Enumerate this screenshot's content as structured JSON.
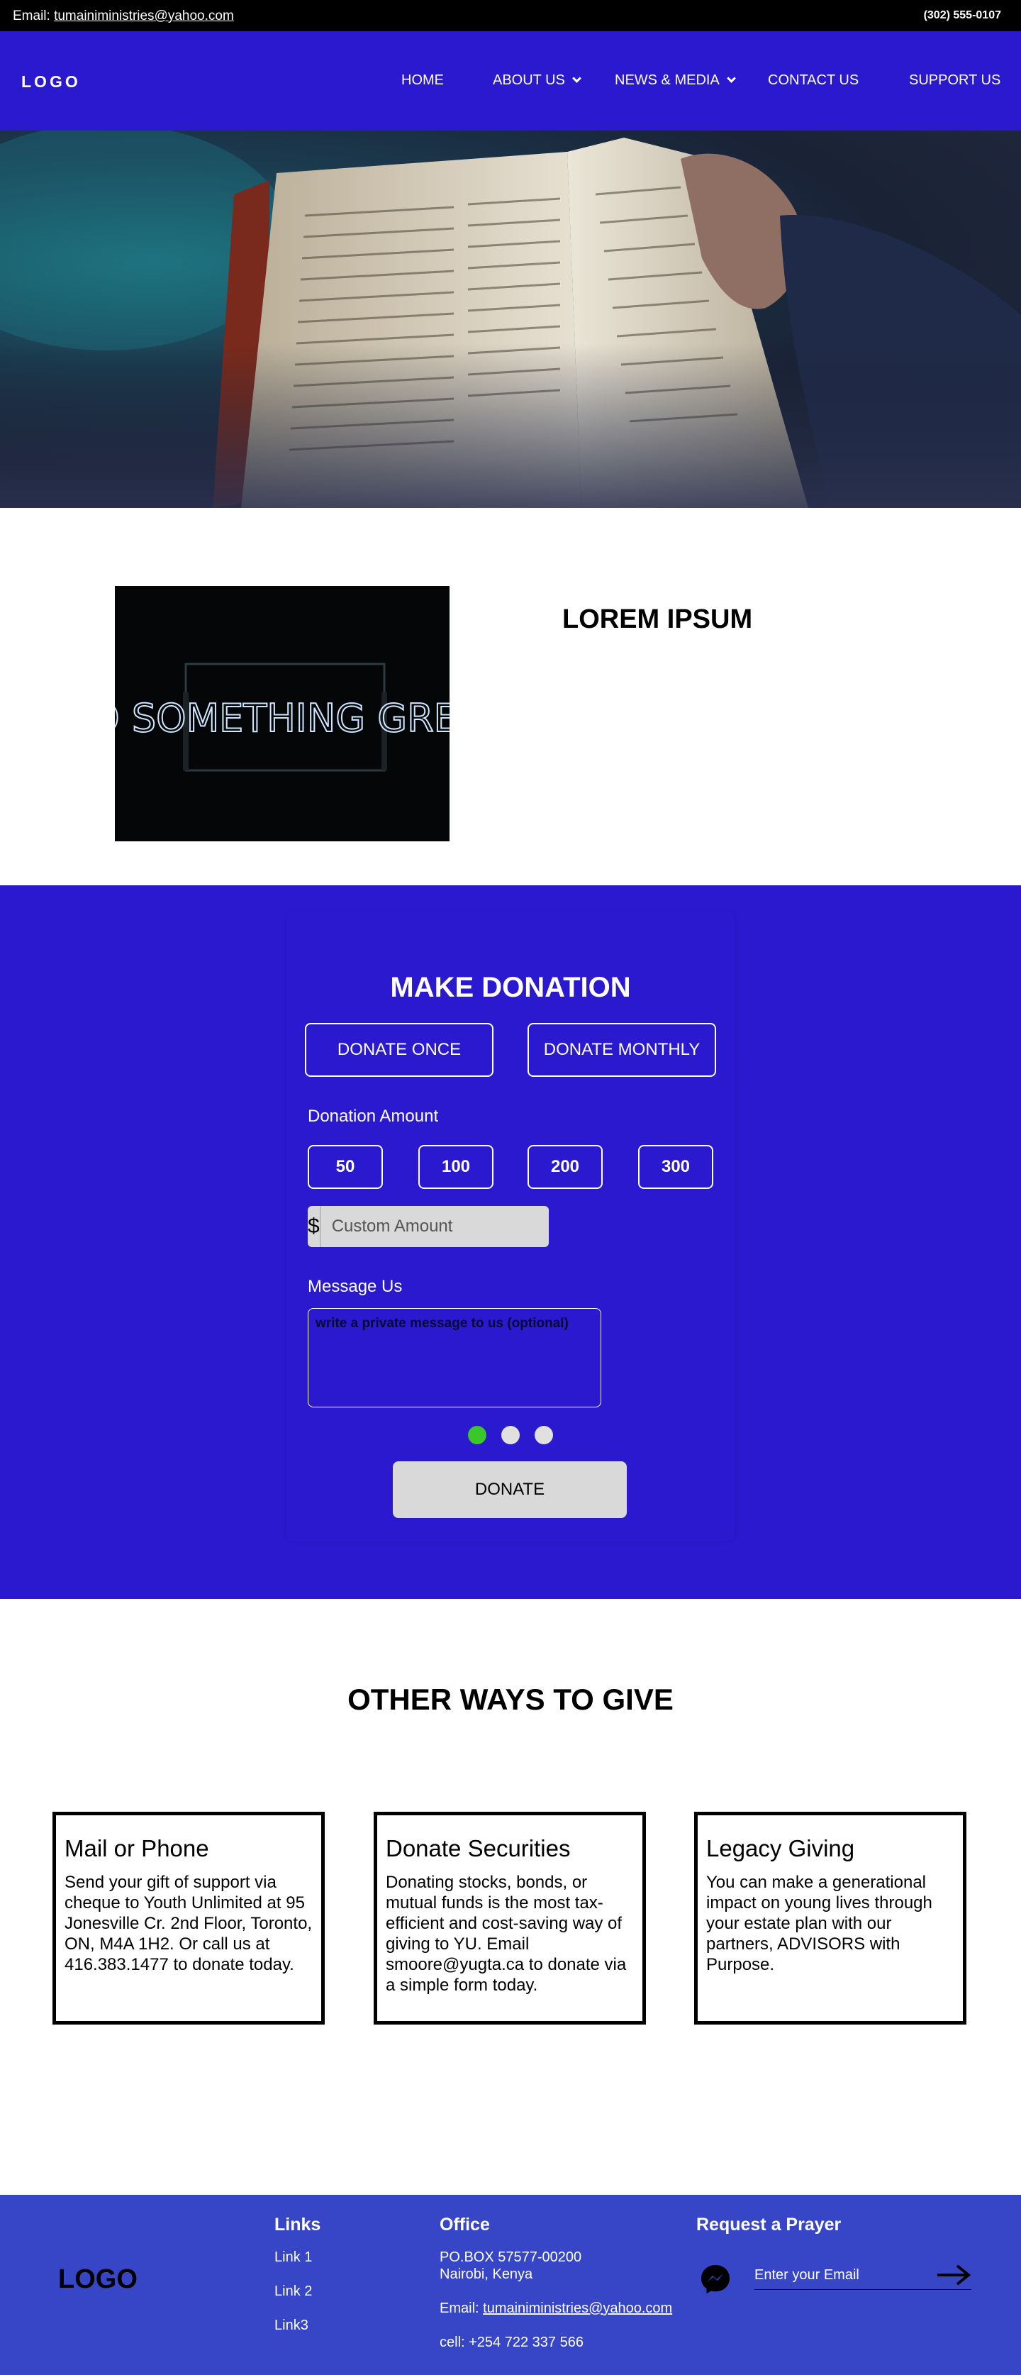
{
  "topbar": {
    "email_label": "Email:",
    "email": "tumainiministries@yahoo.com",
    "phone": "(302) 555-0107"
  },
  "nav": {
    "logo": "LOGO",
    "items": [
      {
        "label": "HOME"
      },
      {
        "label": "ABOUT US",
        "has_dropdown": true
      },
      {
        "label": "NEWS & MEDIA",
        "has_dropdown": true
      },
      {
        "label": "CONTACT US"
      },
      {
        "label": "SUPPORT US"
      }
    ]
  },
  "hero": {
    "image": "open-bible-photo"
  },
  "feature": {
    "image_text": "DO SOMETHING GREAT",
    "title": "LOREM IPSUM"
  },
  "donation": {
    "title": "MAKE DONATION",
    "once_label": "DONATE ONCE",
    "monthly_label": "DONATE MONTHLY",
    "amount_label": "Donation Amount",
    "amounts": [
      "50",
      "100",
      "200",
      "300"
    ],
    "currency_symbol": "$",
    "custom_placeholder": "Custom Amount",
    "message_label": "Message Us",
    "message_placeholder": "write a private message to us (optional)",
    "steps": [
      {
        "active": true,
        "color": "#3bc62a"
      },
      {
        "active": false,
        "color": "#e0e0e0"
      },
      {
        "active": false,
        "color": "#e0e0e0"
      }
    ],
    "submit_label": "DONATE"
  },
  "other_ways": {
    "title": "OTHER WAYS TO GIVE",
    "cards": [
      {
        "title": "Mail or Phone",
        "body": "Send your gift of support via cheque to Youth Unlimited at 95 Jonesville Cr. 2nd Floor, Toronto, ON, M4A 1H2. Or call us at 416.383.1477 to donate today."
      },
      {
        "title": "Donate Securities",
        "body": "Donating stocks, bonds, or mutual funds is the most tax-efficient and cost-saving way of giving to YU. Email smoore@yugta.ca to donate via a simple form today."
      },
      {
        "title": "Legacy Giving",
        "body": "You can make a generational impact on young lives through your estate plan with our partners, ADVISORS with Purpose."
      }
    ]
  },
  "footer": {
    "logo": "LOGO",
    "links_heading": "Links",
    "links": [
      "Link 1",
      "Link 2",
      "Link3"
    ],
    "office_heading": "Office",
    "po_box": "PO.BOX 57577-00200",
    "city": "Nairobi, Kenya",
    "email_label": "Email:",
    "email": "tumainiministries@yahoo.com",
    "cell": "cell: +254 722 337 566",
    "prayer_heading": "Request a Prayer",
    "email_placeholder": "Enter your Email"
  },
  "colors": {
    "brand_blue": "#2b19cf",
    "footer_blue": "#3646c7",
    "active_step": "#3bc62a"
  }
}
